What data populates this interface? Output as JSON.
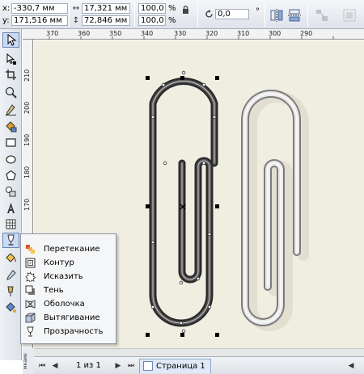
{
  "propbar": {
    "x_label": "x:",
    "x_value": "-330,7 мм",
    "y_label": "y:",
    "y_value": "171,516 мм",
    "width_value": "17,321 мм",
    "height_value": "72,846 мм",
    "scale_x": "100,0",
    "scale_y": "100,0",
    "percent_x": "%",
    "percent_y": "%",
    "rotation_value": "0,0",
    "degree": "°"
  },
  "ruler": {
    "h_labels": [
      "370",
      "360",
      "350",
      "340",
      "330",
      "320",
      "310",
      "300",
      "290"
    ],
    "v_labels": [
      "210",
      "200",
      "190",
      "180",
      "170"
    ]
  },
  "flyout": {
    "items": [
      {
        "label": "Перетекание",
        "icon": "blend-icon"
      },
      {
        "label": "Контур",
        "icon": "contour-icon"
      },
      {
        "label": "Исказить",
        "icon": "distort-icon"
      },
      {
        "label": "Тень",
        "icon": "shadow-icon"
      },
      {
        "label": "Оболочка",
        "icon": "envelope-icon"
      },
      {
        "label": "Вытягивание",
        "icon": "extrude-icon"
      },
      {
        "label": "Прозрачность",
        "icon": "transparency-icon"
      }
    ]
  },
  "statusbar": {
    "page_count": "1 из 1",
    "page_tab": "Страница 1",
    "side_label": "мнаие"
  },
  "colors": {
    "canvas": "#f0ede1",
    "clip_dark": "#2f2f2f",
    "clip_silver": "#b9b9b9",
    "selection_accent": "#c9daf3"
  }
}
